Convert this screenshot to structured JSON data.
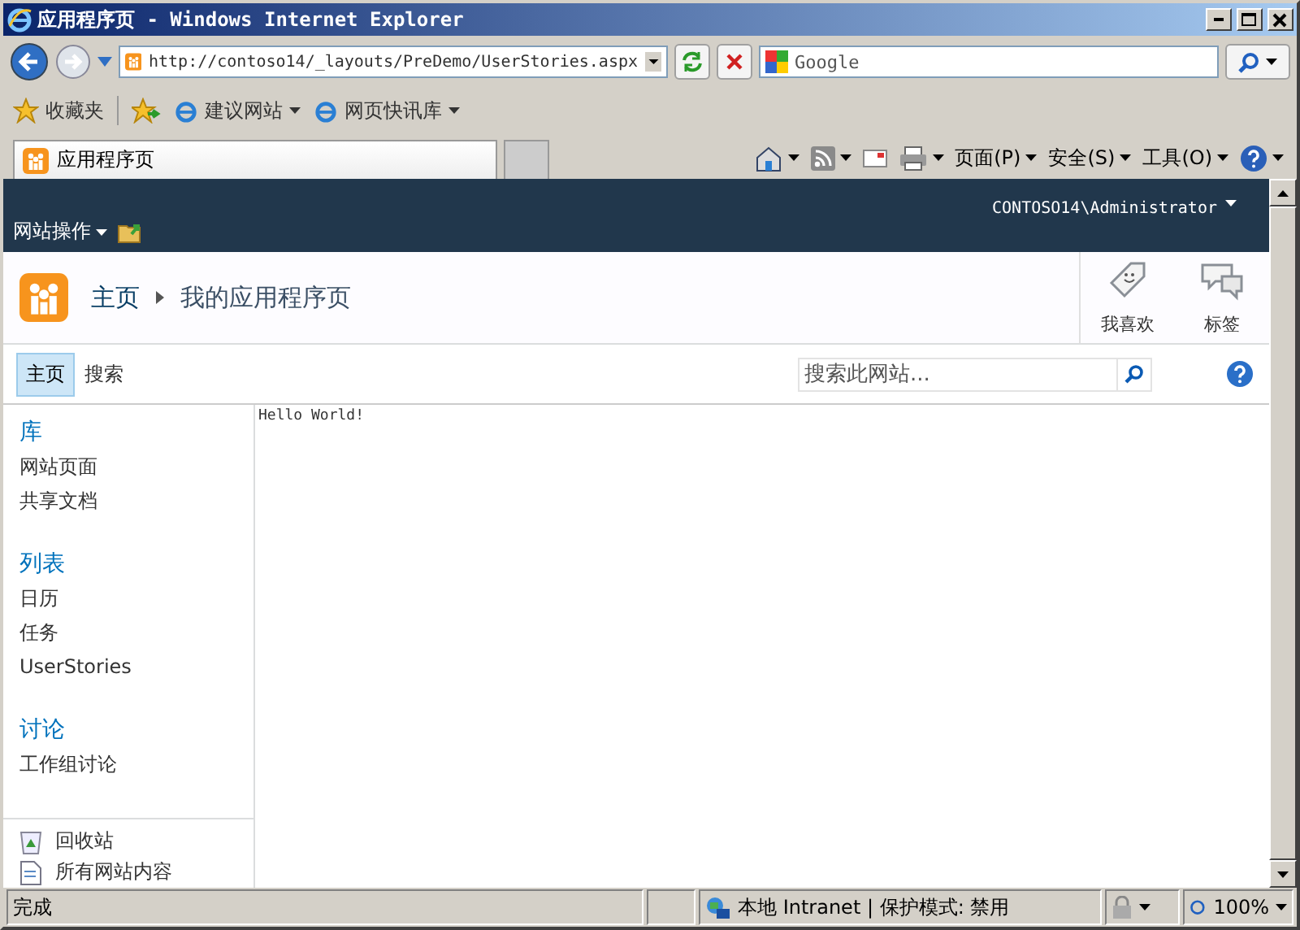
{
  "window": {
    "title": "应用程序页 - Windows Internet Explorer"
  },
  "address_bar": {
    "url": "http://contoso14/_layouts/PreDemo/UserStories.aspx"
  },
  "search_field": {
    "placeholder": "Google"
  },
  "favorites_bar": {
    "label": "收藏夹",
    "links": [
      "建议网站",
      "网页快讯库"
    ]
  },
  "tabs": [
    {
      "label": "应用程序页",
      "selected": true
    }
  ],
  "command_bar": {
    "menus": [
      "页面(P)",
      "安全(S)",
      "工具(O)"
    ]
  },
  "sharepoint": {
    "site_actions": "网站操作",
    "user": "CONTOSO14\\Administrator",
    "breadcrumb": [
      "主页",
      "我的应用程序页"
    ],
    "actions": [
      {
        "kind": "like",
        "label": "我喜欢"
      },
      {
        "kind": "tag",
        "label": "标签"
      }
    ],
    "top_nav": [
      {
        "label": "主页",
        "selected": true
      },
      {
        "label": "搜索",
        "selected": false
      }
    ],
    "search": {
      "placeholder": "搜索此网站..."
    },
    "quick_launch": [
      {
        "heading": "库",
        "items": [
          "网站页面",
          "共享文档"
        ]
      },
      {
        "heading": "列表",
        "items": [
          "日历",
          "任务",
          "UserStories"
        ]
      },
      {
        "heading": "讨论",
        "items": [
          "工作组讨论"
        ]
      }
    ],
    "footer_links": [
      {
        "kind": "recycle",
        "label": "回收站"
      },
      {
        "kind": "content",
        "label": "所有网站内容"
      }
    ],
    "content": "Hello World!"
  },
  "status_bar": {
    "status": "完成",
    "zone": "本地 Intranet | 保护模式: 禁用",
    "zoom": "100%"
  }
}
